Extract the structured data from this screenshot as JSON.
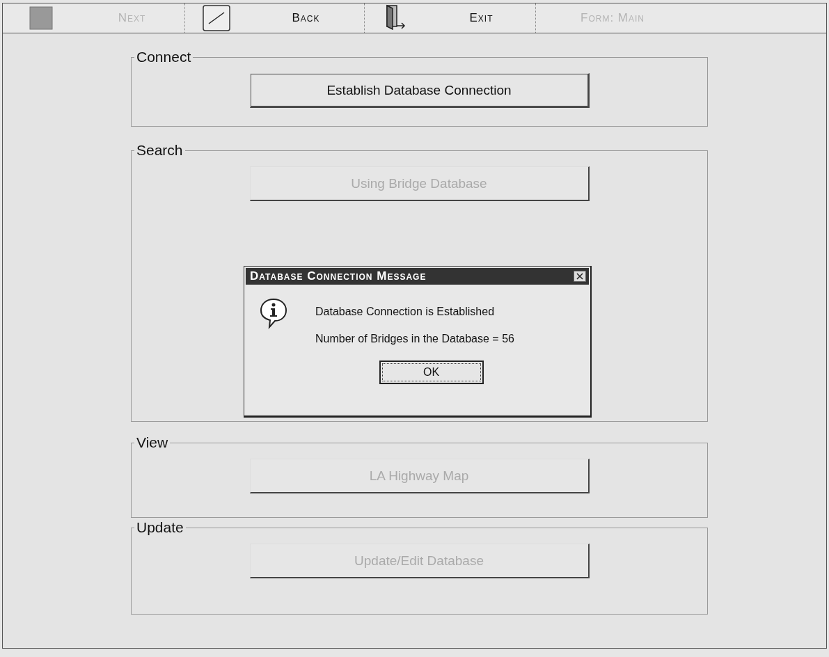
{
  "toolbar": {
    "buttons": [
      {
        "label": "Next",
        "disabled": true
      },
      {
        "label": "Back",
        "disabled": false
      },
      {
        "label": "Exit",
        "disabled": false
      }
    ],
    "form_label": {
      "text": "Form: Main",
      "disabled": true
    }
  },
  "sections": [
    {
      "title": "Connect",
      "button": {
        "label": "Establish Database Connection",
        "disabled": false
      }
    },
    {
      "title": "Search",
      "button": {
        "label": "Using Bridge Database",
        "disabled": true
      }
    },
    {
      "title": "View",
      "button": {
        "label": "LA Highway Map",
        "disabled": true
      }
    },
    {
      "title": "Update",
      "button": {
        "label": "Update/Edit Database",
        "disabled": true
      }
    }
  ],
  "dialog": {
    "title": "Database Connection Message",
    "lines": [
      "Database Connection is Established",
      "Number of Bridges in the Database = 56"
    ],
    "button": "OK"
  }
}
